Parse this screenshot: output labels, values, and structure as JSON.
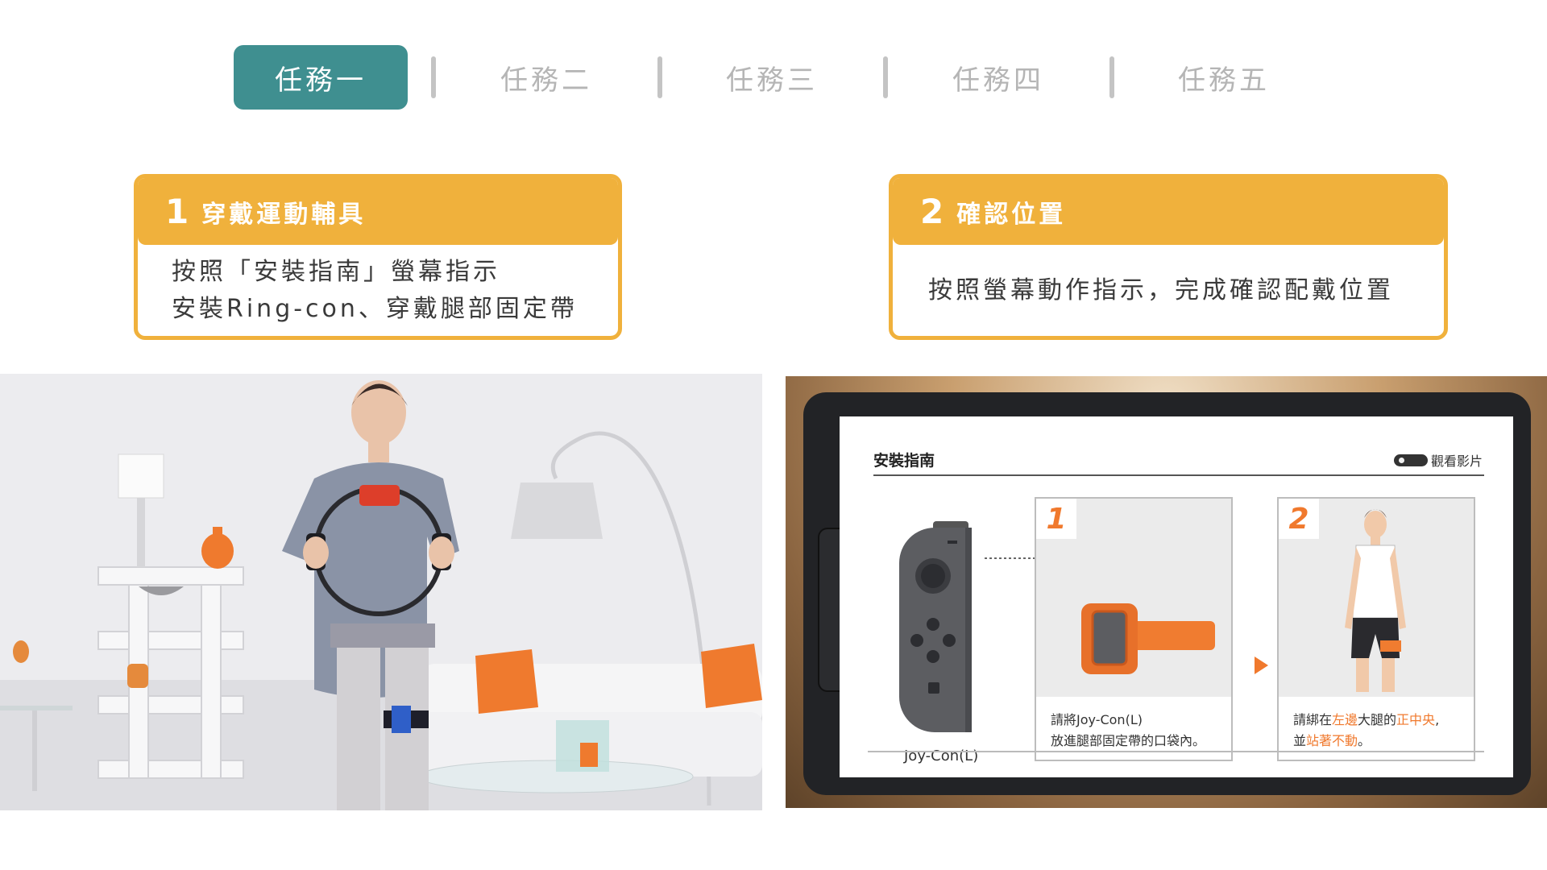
{
  "tabs": [
    {
      "label": "任務一",
      "active": true
    },
    {
      "label": "任務二",
      "active": false
    },
    {
      "label": "任務三",
      "active": false
    },
    {
      "label": "任務四",
      "active": false
    },
    {
      "label": "任務五",
      "active": false
    }
  ],
  "steps": [
    {
      "number": "1",
      "title": "穿戴運動輔具",
      "lines": [
        "按照「安裝指南」螢幕指示",
        "安裝Ring-con、穿戴腿部固定帶"
      ]
    },
    {
      "number": "2",
      "title": "確認位置",
      "lines": [
        "按照螢幕動作指示，完成確認配戴位置"
      ]
    }
  ],
  "tablet": {
    "title": "安裝指南",
    "video_label": "觀看影片",
    "joycon_label": "Joy-Con(L)",
    "panel1": {
      "number": "1",
      "caption_line1": "請將Joy-Con(L)",
      "caption_line2": "放進腿部固定帶的口袋內。"
    },
    "panel2": {
      "number": "2",
      "cap_a": "請綁在",
      "cap_b": "左邊",
      "cap_c": "大腿的",
      "cap_d": "正中央",
      "cap_e": ",",
      "cap_f": "並",
      "cap_g": "站著不動",
      "cap_h": "。"
    }
  },
  "colors": {
    "teal": "#3f8f90",
    "gold": "#f0b13c",
    "orange": "#f0792d",
    "tab_inactive": "#b5b5b5"
  },
  "icons": [
    "video-icon",
    "arrow-right-icon"
  ]
}
